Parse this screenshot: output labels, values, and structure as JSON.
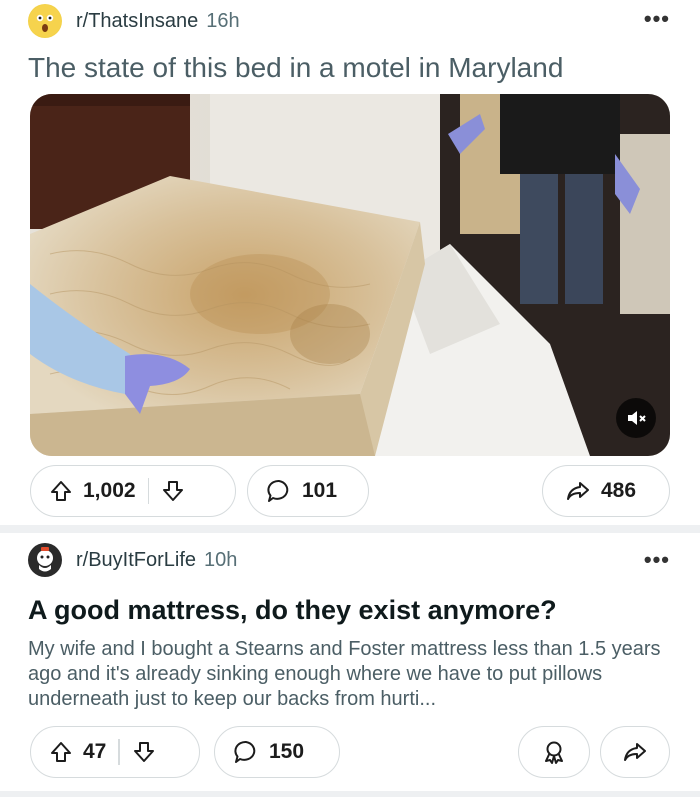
{
  "post1": {
    "subreddit": "r/ThatsInsane",
    "time": "16h",
    "more": "•••",
    "title": "The state of this bed in a motel in Maryland",
    "image_alt": "Stained mattress on a motel bed with gloved inspectors",
    "upvotes": "1,002",
    "comments": "101",
    "shares": "486"
  },
  "post2": {
    "subreddit": "r/BuyItForLife",
    "time": "10h",
    "more": "•••",
    "title": "A good mattress, do they exist anymore?",
    "body": "My wife and I bought a Stearns and Foster mattress less than 1.5 years ago and it's already sinking enough where we have to put pillows underneath just to keep our backs from hurti...",
    "upvotes": "47",
    "comments": "150"
  },
  "colors": {
    "title_gray": "#4b5e65",
    "border": "#d6dbdd",
    "divider": "#eef0f2"
  },
  "icons": [
    "upvote-icon",
    "downvote-icon",
    "comment-icon",
    "share-icon",
    "award-icon",
    "mute-icon"
  ]
}
